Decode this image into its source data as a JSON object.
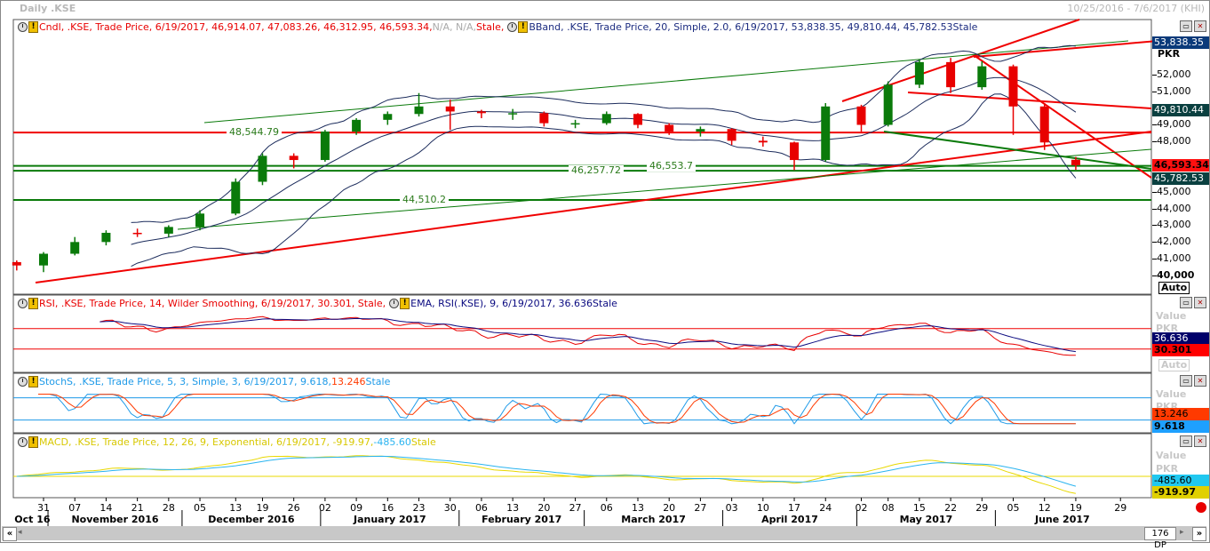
{
  "window": {
    "title": "Daily .KSE",
    "range": "10/25/2016 - 7/6/2017 (KHI)",
    "dp": "176 DP"
  },
  "legends": {
    "price": {
      "cndl": "Cndl, .KSE, Trade Price, 6/19/2017, 46,914.07, 47,083.26, 46,312.95, 46,593.34,",
      "na": " N/A, N/A,",
      "stale": " Stale,",
      "bband": "BBand, .KSE, Trade Price,  20, Simple, 2.0, 6/19/2017, 53,838.35, 49,810.44, 45,782.53Stale"
    },
    "rsi": {
      "rsi": "RSI, .KSE, Trade Price,  14, Wilder Smoothing, 6/19/2017, 30.301,  Stale,",
      "ema": "EMA, RSI(.KSE),  9, 6/19/2017, 36.636Stale"
    },
    "stoch": {
      "a": "StochS, .KSE, Trade Price,  5, 3, Simple, 3, 6/19/2017, 9.618,",
      "b": " 13.246",
      "c": "Stale"
    },
    "macd": {
      "a": "MACD, .KSE, Trade Price,  12, 26, 9, Exponential, 6/19/2017, -919.97,",
      "b": " -485.60",
      "c": "Stale"
    }
  },
  "price_axis": {
    "unit": "PKR",
    "ticks": [
      "52,000",
      "51,000",
      "49,000",
      "48,000",
      "45,000",
      "44,000",
      "43,000",
      "42,000",
      "41,000",
      "40,000"
    ],
    "auto": "Auto",
    "badges": {
      "bb_upper": "53,838.35",
      "bb_mid": "49,810.44",
      "last": "46,593.34",
      "bb_lower": "45,782.53"
    }
  },
  "rsi_axis": {
    "value": "Value",
    "unit": "PKR",
    "ema": "36.636",
    "rsi": "30.301",
    "auto": "Auto"
  },
  "stoch_axis": {
    "value": "Value",
    "unit": "PKR",
    "d": "13.246",
    "k": "9.618"
  },
  "macd_axis": {
    "value": "Value",
    "unit": "PKR",
    "signal": "-485.60",
    "macd": "-919.97"
  },
  "colors": {
    "up": "#0a7a0a",
    "down": "#e80000",
    "band": "#1c2c5c",
    "rsi": "#e80000",
    "ema": "#0a0a80",
    "stochK": "#1e9ae8",
    "stochD": "#ff3a00",
    "macd": "#e8d800",
    "signal": "#2ab4f0"
  },
  "chart_data": {
    "type": "candlestick",
    "title": "Daily .KSE",
    "ylabel": "PKR",
    "ylim": [
      40000,
      53000
    ],
    "candles": [
      [
        "2016-10-25",
        40800,
        40900,
        40300,
        40600
      ],
      [
        "2016-10-31",
        40600,
        41400,
        40200,
        41300
      ],
      [
        "2016-11-07",
        41300,
        42300,
        41200,
        42000
      ],
      [
        "2016-11-14",
        42000,
        42700,
        41800,
        42550
      ],
      [
        "2016-11-21",
        42550,
        42800,
        42300,
        42500
      ],
      [
        "2016-11-28",
        42500,
        43000,
        42300,
        42900
      ],
      [
        "2016-12-05",
        42900,
        43900,
        42700,
        43700
      ],
      [
        "2016-12-13",
        43700,
        45800,
        43600,
        45600
      ],
      [
        "2016-12-19",
        45600,
        47300,
        45400,
        47150
      ],
      [
        "2016-12-26",
        47150,
        47300,
        46400,
        46900
      ],
      [
        "2017-01-02",
        46900,
        48700,
        46800,
        48600
      ],
      [
        "2017-01-09",
        48600,
        49400,
        48400,
        49300
      ],
      [
        "2017-01-16",
        49300,
        49800,
        49000,
        49650
      ],
      [
        "2017-01-23",
        49650,
        50900,
        49500,
        50100
      ],
      [
        "2017-01-30",
        50100,
        50500,
        48700,
        49800
      ],
      [
        "2017-02-06",
        49800,
        49900,
        49400,
        49700
      ],
      [
        "2017-02-13",
        49700,
        49950,
        49300,
        49700
      ],
      [
        "2017-02-20",
        49700,
        49800,
        48900,
        49100
      ],
      [
        "2017-02-27",
        49100,
        49300,
        48800,
        49100
      ],
      [
        "2017-03-06",
        49100,
        49800,
        49000,
        49650
      ],
      [
        "2017-03-13",
        49650,
        49700,
        48800,
        49000
      ],
      [
        "2017-03-20",
        49000,
        49100,
        48400,
        48600
      ],
      [
        "2017-03-27",
        48600,
        48900,
        48300,
        48750
      ],
      [
        "2017-04-03",
        48750,
        48800,
        47800,
        48050
      ],
      [
        "2017-04-10",
        48050,
        48300,
        47700,
        47950
      ],
      [
        "2017-04-17",
        47950,
        48000,
        46300,
        46900
      ],
      [
        "2017-04-24",
        46900,
        50300,
        46800,
        50100
      ],
      [
        "2017-05-02",
        50100,
        50200,
        48600,
        49000
      ],
      [
        "2017-05-08",
        49000,
        51600,
        48900,
        51400
      ],
      [
        "2017-05-15",
        51400,
        52900,
        51200,
        52750
      ],
      [
        "2017-05-22",
        52750,
        53000,
        50900,
        51250
      ],
      [
        "2017-05-29",
        51250,
        52800,
        51100,
        52500
      ],
      [
        "2017-06-05",
        52500,
        52600,
        48400,
        50100
      ],
      [
        "2017-06-12",
        50100,
        50300,
        47500,
        47950
      ],
      [
        "2017-06-19",
        46914.07,
        47083.26,
        46312.95,
        46593.34
      ]
    ],
    "hlines": [
      {
        "value": 48544.79,
        "label": "48,544.79",
        "color": "red"
      },
      {
        "value": 46553.7,
        "label": "46,553.7",
        "color": "green"
      },
      {
        "value": 46257.72,
        "label": "46,257.72",
        "color": "green"
      },
      {
        "value": 44510.2,
        "label": "44,510.2",
        "color": "green"
      }
    ],
    "rsi_levels": [
      70,
      30
    ],
    "stoch_levels": [
      80,
      20
    ],
    "x_ticks": [
      [
        "2016-10-31",
        "31"
      ],
      [
        "2016-11-07",
        "07"
      ],
      [
        "2016-11-14",
        "14"
      ],
      [
        "2016-11-21",
        "21"
      ],
      [
        "2016-11-28",
        "28"
      ],
      [
        "2016-12-05",
        "05"
      ],
      [
        "2016-12-13",
        "13"
      ],
      [
        "2016-12-19",
        "19"
      ],
      [
        "2016-12-26",
        "26"
      ],
      [
        "2017-01-02",
        "02"
      ],
      [
        "2017-01-09",
        "09"
      ],
      [
        "2017-01-16",
        "16"
      ],
      [
        "2017-01-23",
        "23"
      ],
      [
        "2017-01-30",
        "30"
      ],
      [
        "2017-02-06",
        "06"
      ],
      [
        "2017-02-13",
        "13"
      ],
      [
        "2017-02-20",
        "20"
      ],
      [
        "2017-02-27",
        "27"
      ],
      [
        "2017-03-06",
        "06"
      ],
      [
        "2017-03-13",
        "13"
      ],
      [
        "2017-03-20",
        "20"
      ],
      [
        "2017-03-27",
        "27"
      ],
      [
        "2017-04-03",
        "03"
      ],
      [
        "2017-04-10",
        "10"
      ],
      [
        "2017-04-17",
        "17"
      ],
      [
        "2017-04-24",
        "24"
      ],
      [
        "2017-05-02",
        "02"
      ],
      [
        "2017-05-08",
        "08"
      ],
      [
        "2017-05-15",
        "15"
      ],
      [
        "2017-05-22",
        "22"
      ],
      [
        "2017-05-29",
        "29"
      ],
      [
        "2017-06-05",
        "05"
      ],
      [
        "2017-06-12",
        "12"
      ],
      [
        "2017-06-19",
        "19"
      ],
      [
        "2017-06-29",
        "29"
      ]
    ],
    "months": [
      [
        "Oct 16",
        "2016-10-25",
        "2016-11-01"
      ],
      [
        "November 2016",
        "2016-11-01",
        "2016-12-01"
      ],
      [
        "December 2016",
        "2016-12-01",
        "2017-01-01"
      ],
      [
        "January 2017",
        "2017-01-01",
        "2017-02-01"
      ],
      [
        "February 2017",
        "2017-02-01",
        "2017-03-01"
      ],
      [
        "March 2017",
        "2017-03-01",
        "2017-04-01"
      ],
      [
        "April 2017",
        "2017-04-01",
        "2017-05-01"
      ],
      [
        "May 2017",
        "2017-05-01",
        "2017-06-01"
      ],
      [
        "June 2017",
        "2017-06-01",
        "2017-07-01"
      ]
    ]
  }
}
